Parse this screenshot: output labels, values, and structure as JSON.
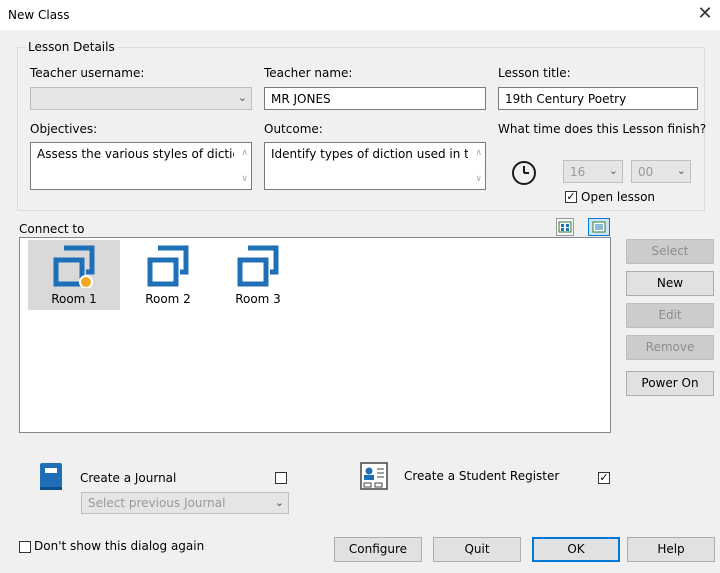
{
  "window": {
    "title": "New Class",
    "close_glyph": "✕"
  },
  "lesson_details": {
    "group_title": "Lesson Details",
    "teacher_username_label": "Teacher username:",
    "teacher_username_value": "",
    "teacher_name_label": "Teacher name:",
    "teacher_name_value": "MR JONES",
    "lesson_title_label": "Lesson title:",
    "lesson_title_value": "19th Century Poetry",
    "objectives_label": "Objectives:",
    "objectives_value": "Assess the various styles of diction",
    "outcome_label": "Outcome:",
    "outcome_value": "Identify types of diction used in tel",
    "finish_time_label": "What time does this Lesson finish?",
    "finish_hour": "16",
    "finish_minute": "00",
    "open_lesson_label": "Open lesson",
    "open_lesson_checked": true
  },
  "connect_to": {
    "label": "Connect to",
    "view_icons": [
      "large-icons-view-icon",
      "details-view-icon"
    ],
    "rooms": [
      {
        "label": "Room 1",
        "selected": true,
        "status": "active"
      },
      {
        "label": "Room 2",
        "selected": false
      },
      {
        "label": "Room 3",
        "selected": false
      }
    ]
  },
  "side_buttons": {
    "select": "Select",
    "new": "New",
    "edit": "Edit",
    "remove": "Remove",
    "power_on": "Power On"
  },
  "journal": {
    "label": "Create a Journal",
    "checked": false,
    "select_placeholder": "Select previous Journal"
  },
  "register": {
    "label": "Create a Student Register",
    "checked": true
  },
  "footer": {
    "dont_show_label": "Don't show this dialog again",
    "dont_show_checked": false,
    "configure": "Configure",
    "quit": "Quit",
    "ok": "OK",
    "help": "Help"
  },
  "colors": {
    "accent": "#1e6fb8",
    "status_dot": "#f5a623",
    "selection": "#d9d9d9"
  }
}
